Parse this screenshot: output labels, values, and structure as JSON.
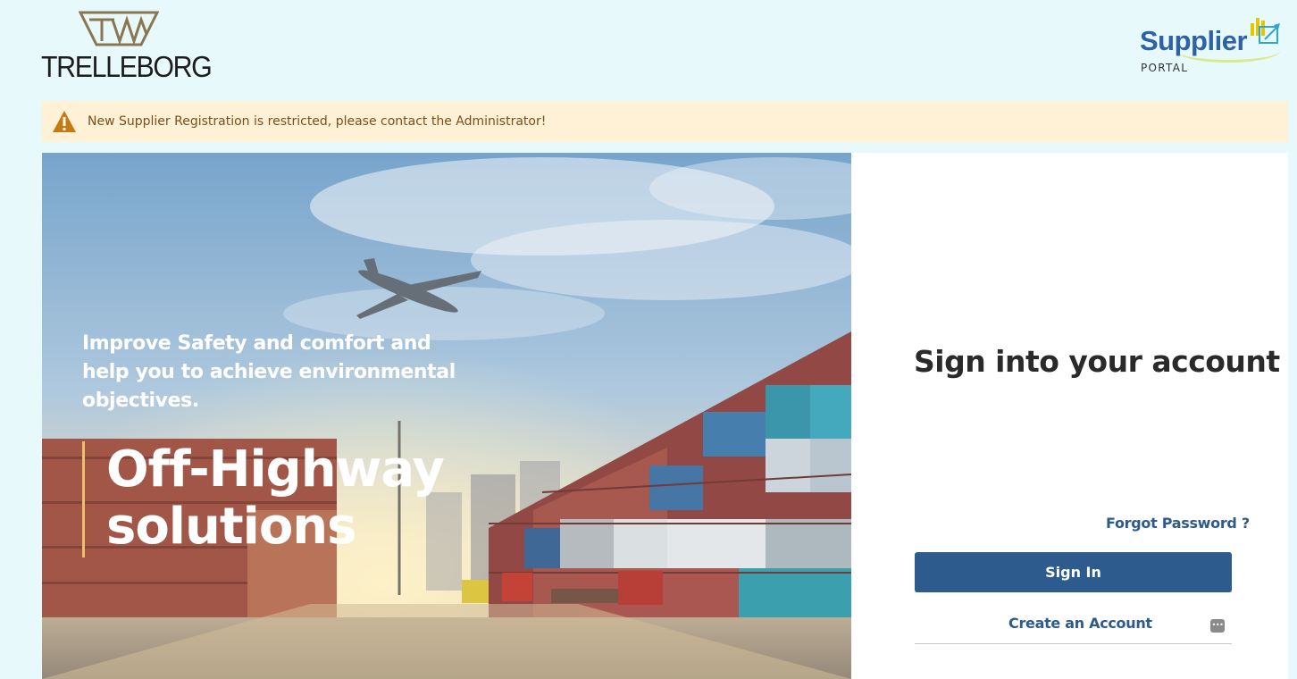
{
  "header": {
    "logo_text": "TRELLEBORG",
    "portal_logo": {
      "title": "Supplier",
      "subtitle": "PORTAL"
    }
  },
  "banner": {
    "icon": "warning-icon",
    "message": "New Supplier Registration is restricted, please contact the Administrator!"
  },
  "hero": {
    "tagline": "Improve Safety and comfort and help you to achieve environmental objectives.",
    "headline_line1": "Off-Highway",
    "headline_line2": "solutions"
  },
  "signin": {
    "title": "Sign into your account",
    "username_value": "",
    "password_value": "",
    "field_icon": "password-manager-icon",
    "forgot_label": "Forgot Password ?",
    "submit_label": "Sign In",
    "create_label": "Create an Account"
  },
  "colors": {
    "page_bg": "#e8f9fb",
    "banner_bg": "#fff1d6",
    "primary": "#2e5b8e",
    "link": "#2d5b8c",
    "accent_gold": "#e8c16a"
  }
}
